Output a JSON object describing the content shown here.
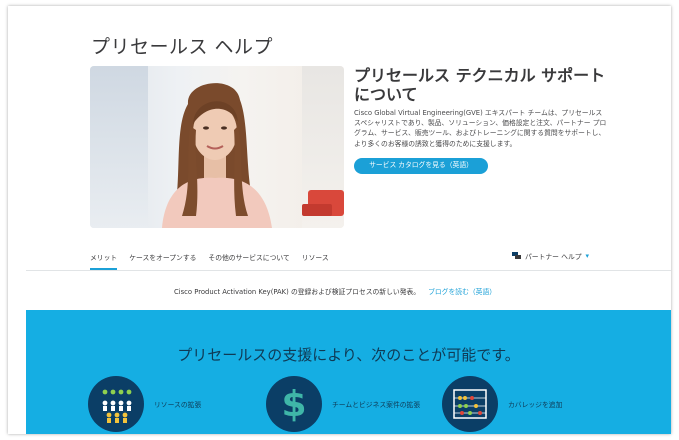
{
  "page": {
    "title": "プリセールス ヘルプ"
  },
  "hero": {
    "heading": "プリセールス テクニカル サポート について",
    "description": "Cisco Global Virtual Engineering(GVE) エキスパート チームは、プリセールス スペシャリストであり、製品、ソリューション、価格設定と注文、パートナー プログラム、サービス、販売ツール、およびトレーニングに関する質問をサポートし、より多くのお客様の誘致と獲得のために支援します。",
    "button_label": "サービス カタログを見る（英語）"
  },
  "tabs": [
    {
      "label": "メリット",
      "active": true
    },
    {
      "label": "ケースをオープンする",
      "active": false
    },
    {
      "label": "その他のサービスについて",
      "active": false
    },
    {
      "label": "リソース",
      "active": false
    }
  ],
  "partner_help": {
    "label": "パートナー ヘルプ",
    "icon": "chat-icon"
  },
  "notice": {
    "text": "Cisco Product Activation Key(PAK) の登録および検証プロセスの新しい発表。",
    "link": "ブログを読む（英語）"
  },
  "band": {
    "title": "プリセールスの支援により、次のことが可能です。",
    "features": [
      {
        "label": "リソースの拡張",
        "icon": "people-grid-icon"
      },
      {
        "label": "チームとビジネス案件の拡張",
        "icon": "dollar-icon"
      },
      {
        "label": "カバレッジを追加",
        "icon": "abacus-icon"
      }
    ]
  },
  "colors": {
    "accent": "#1ba0d7",
    "band": "#15aee3",
    "icon_bg": "#0b3e66"
  }
}
